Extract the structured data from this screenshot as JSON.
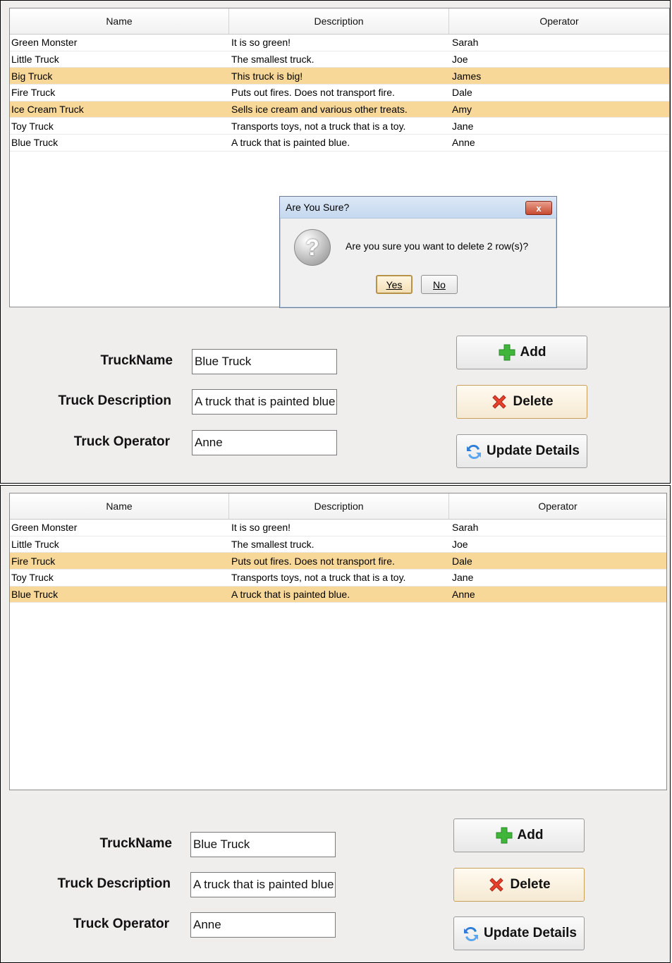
{
  "columns": [
    "Name",
    "Description",
    "Operator"
  ],
  "panel1": {
    "rows": [
      {
        "name": "Green Monster",
        "description": "It is so green!",
        "operator": "Sarah",
        "selected": false
      },
      {
        "name": "Little Truck",
        "description": "The smallest truck.",
        "operator": "Joe",
        "selected": false
      },
      {
        "name": "Big Truck",
        "description": "This truck is big!",
        "operator": "James",
        "selected": true
      },
      {
        "name": "Fire Truck",
        "description": "Puts out fires. Does not transport fire.",
        "operator": "Dale",
        "selected": false
      },
      {
        "name": "Ice Cream Truck",
        "description": "Sells ice cream and various other treats.",
        "operator": "Amy",
        "selected": true
      },
      {
        "name": "Toy Truck",
        "description": "Transports toys, not a truck that is a toy.",
        "operator": "Jane",
        "selected": false
      },
      {
        "name": "Blue Truck",
        "description": "A truck that is painted blue.",
        "operator": "Anne",
        "selected": false
      }
    ],
    "dialog": {
      "title": "Are You Sure?",
      "message": "Are you sure you want to delete 2 row(s)?",
      "yes_label": "Yes",
      "no_label": "No",
      "close_glyph": "x",
      "icon": "question-icon"
    }
  },
  "panel2": {
    "rows": [
      {
        "name": "Green Monster",
        "description": "It is so green!",
        "operator": "Sarah",
        "selected": false
      },
      {
        "name": "Little Truck",
        "description": "The smallest truck.",
        "operator": "Joe",
        "selected": false
      },
      {
        "name": "Fire Truck",
        "description": "Puts out fires. Does not transport fire.",
        "operator": "Dale",
        "selected": true
      },
      {
        "name": "Toy Truck",
        "description": "Transports toys, not a truck that is a toy.",
        "operator": "Jane",
        "selected": false
      },
      {
        "name": "Blue Truck",
        "description": "A truck that is painted blue.",
        "operator": "Anne",
        "selected": true
      }
    ]
  },
  "form": {
    "name_label": "TruckName",
    "description_label": "Truck Description",
    "operator_label": "Truck Operator",
    "name_value": "Blue Truck",
    "description_value": "A truck that is painted blue.",
    "operator_value": "Anne"
  },
  "buttons": {
    "add_label": "Add",
    "delete_label": "Delete",
    "update_label": "Update Details",
    "add_icon": "plus-icon",
    "delete_icon": "delete-x-icon",
    "update_icon": "refresh-icon"
  },
  "colors": {
    "selection": "#f8d898",
    "add_green": "#3fb53a",
    "delete_red": "#e8412b",
    "refresh_blue": "#2f7fd8"
  }
}
